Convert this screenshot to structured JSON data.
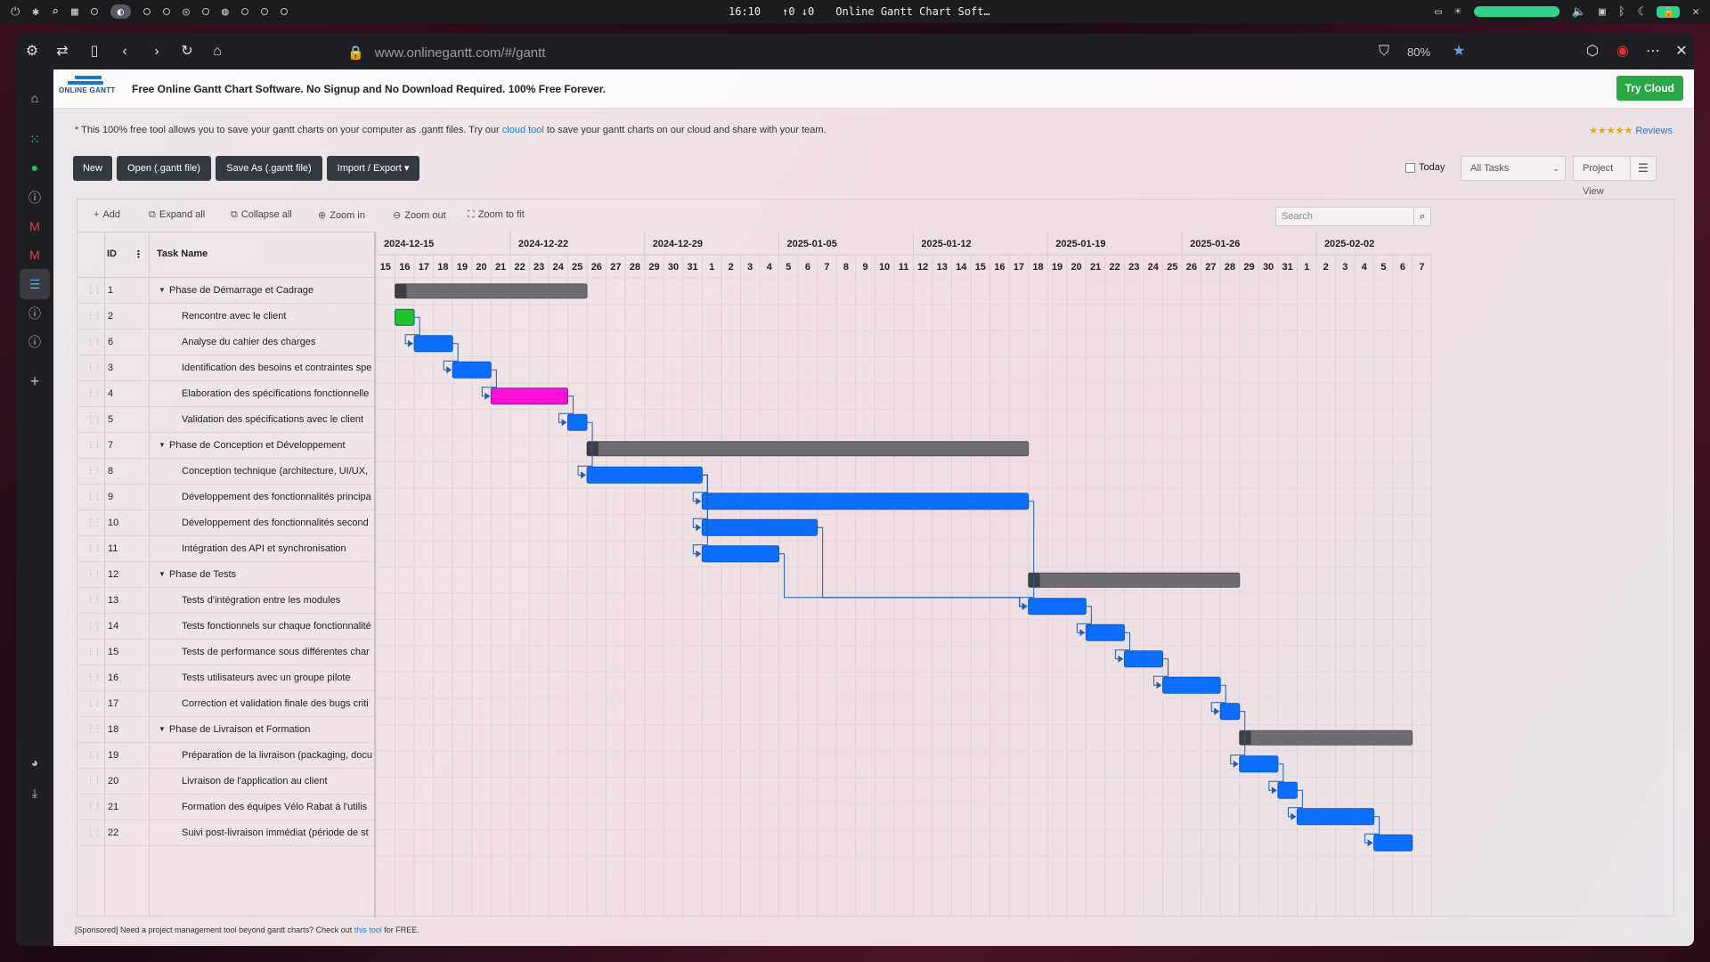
{
  "system_bar": {
    "time": "16:10",
    "net": "↑0 ↓0",
    "window_title": "Online Gantt Chart Soft…"
  },
  "browser": {
    "url": "www.onlinegantt.com/#/gantt",
    "zoom": "80%"
  },
  "banner": {
    "title": "Free Online Gantt Chart Software. No Signup and No Download Required. 100% Free Forever.",
    "logo_text": "ONLINE GANTT",
    "try_cloud": "Try Cloud"
  },
  "notice": {
    "before": "* This 100% free tool allows you to save your gantt charts on your computer as .gantt files. Try our ",
    "link": "cloud tool",
    "after": " to save your gantt charts on our cloud and share with your team.",
    "stars": "★★★★★",
    "reviews": "Reviews"
  },
  "actions": {
    "new": "New",
    "open": "Open (.gantt file)",
    "save_as": "Save As (.gantt file)",
    "import_export": "Import / Export ▾",
    "today": "Today",
    "filter": "All Tasks",
    "view": "Project View"
  },
  "gantt_toolbar": {
    "add": "Add",
    "expand": "Expand all",
    "collapse": "Collapse all",
    "zoom_in": "Zoom in",
    "zoom_out": "Zoom out",
    "zoom_fit": "Zoom to fit",
    "search_placeholder": "Search"
  },
  "grid_header": {
    "id": "ID",
    "name": "Task Name"
  },
  "weeks": [
    "2024-12-15",
    "2024-12-22",
    "2024-12-29",
    "2025-01-05",
    "2025-01-12",
    "2025-01-19",
    "2025-01-26",
    "2025-02-02"
  ],
  "days": [
    "15",
    "16",
    "17",
    "18",
    "19",
    "20",
    "21",
    "22",
    "23",
    "24",
    "25",
    "26",
    "27",
    "28",
    "29",
    "30",
    "31",
    "1",
    "2",
    "3",
    "4",
    "5",
    "6",
    "7",
    "8",
    "9",
    "10",
    "11",
    "12",
    "13",
    "14",
    "15",
    "16",
    "17",
    "18",
    "19",
    "20",
    "21",
    "22",
    "23",
    "24",
    "25",
    "26",
    "27",
    "28",
    "29",
    "30",
    "31",
    "1",
    "2",
    "3",
    "4",
    "5",
    "6",
    "7"
  ],
  "tasks": [
    {
      "id": "1",
      "name": "Phase de Démarrage et Cadrage",
      "phase": true,
      "start": "2024-12-16",
      "end": "2024-12-25"
    },
    {
      "id": "2",
      "name": "Rencontre avec le client",
      "phase": false,
      "start": "2024-12-16",
      "end": "2024-12-16",
      "color": "green"
    },
    {
      "id": "6",
      "name": "Analyse du cahier des charges",
      "phase": false,
      "start": "2024-12-17",
      "end": "2024-12-18"
    },
    {
      "id": "3",
      "name": "Identification des besoins et contraintes spe",
      "phase": false,
      "start": "2024-12-19",
      "end": "2024-12-20"
    },
    {
      "id": "4",
      "name": "Elaboration des spécifications fonctionnelle",
      "phase": false,
      "start": "2024-12-21",
      "end": "2024-12-24",
      "color": "magenta"
    },
    {
      "id": "5",
      "name": "Validation des spécifications avec le client",
      "phase": false,
      "start": "2024-12-25",
      "end": "2024-12-25"
    },
    {
      "id": "7",
      "name": "Phase de Conception et Développement",
      "phase": true,
      "start": "2024-12-26",
      "end": "2025-01-17"
    },
    {
      "id": "8",
      "name": "Conception technique (architecture, UI/UX,",
      "phase": false,
      "start": "2024-12-26",
      "end": "2024-12-31"
    },
    {
      "id": "9",
      "name": "Développement des fonctionnalités principa",
      "phase": false,
      "start": "2025-01-01",
      "end": "2025-01-17"
    },
    {
      "id": "10",
      "name": "Développement des fonctionnalités second",
      "phase": false,
      "start": "2025-01-01",
      "end": "2025-01-06"
    },
    {
      "id": "11",
      "name": "Intégration des API et synchronisation",
      "phase": false,
      "start": "2025-01-01",
      "end": "2025-01-04"
    },
    {
      "id": "12",
      "name": "Phase de Tests",
      "phase": true,
      "start": "2025-01-18",
      "end": "2025-01-28"
    },
    {
      "id": "13",
      "name": "Tests d'intégration entre les modules",
      "phase": false,
      "start": "2025-01-18",
      "end": "2025-01-20"
    },
    {
      "id": "14",
      "name": "Tests fonctionnels sur chaque fonctionnalité",
      "phase": false,
      "start": "2025-01-21",
      "end": "2025-01-22"
    },
    {
      "id": "15",
      "name": "Tests de performance sous différentes char",
      "phase": false,
      "start": "2025-01-23",
      "end": "2025-01-24"
    },
    {
      "id": "16",
      "name": "Tests utilisateurs avec un groupe pilote",
      "phase": false,
      "start": "2025-01-25",
      "end": "2025-01-27"
    },
    {
      "id": "17",
      "name": "Correction et validation finale des bugs criti",
      "phase": false,
      "start": "2025-01-28",
      "end": "2025-01-28"
    },
    {
      "id": "18",
      "name": "Phase de Livraison et Formation",
      "phase": true,
      "start": "2025-01-29",
      "end": "2025-02-06"
    },
    {
      "id": "19",
      "name": "Préparation de la livraison (packaging, docu",
      "phase": false,
      "start": "2025-01-29",
      "end": "2025-01-30"
    },
    {
      "id": "20",
      "name": "Livraison de l'application au client",
      "phase": false,
      "start": "2025-01-31",
      "end": "2025-01-31"
    },
    {
      "id": "21",
      "name": "Formation des équipes Vélo Rabat à l'utilis",
      "phase": false,
      "start": "2025-02-01",
      "end": "2025-02-04"
    },
    {
      "id": "22",
      "name": "Suivi post-livraison immédiat (période de st",
      "phase": false,
      "start": "2025-02-05",
      "end": "2025-02-06"
    }
  ],
  "colors": {
    "task": "#0d6efd",
    "phase": "#6c6c72",
    "green": "#22c02a",
    "magenta": "#ff10d8"
  },
  "footer": {
    "before": "[Sponsored] Need a project management tool beyond gantt charts? Check out ",
    "link": "this tool",
    "after": " for FREE."
  }
}
